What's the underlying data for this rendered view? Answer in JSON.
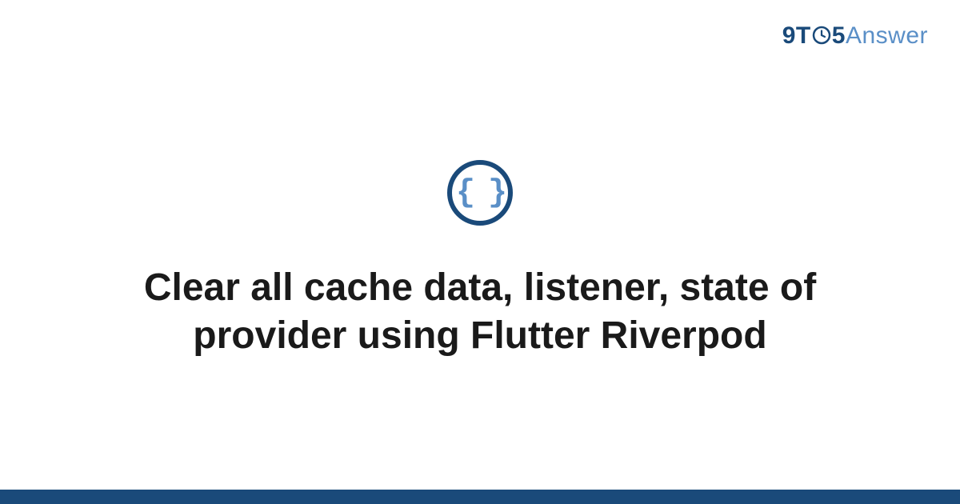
{
  "header": {
    "logo": {
      "prefix": "9T",
      "suffix": "5",
      "answer": "Answer"
    }
  },
  "main": {
    "icon_label": "{ }",
    "title": "Clear all cache data, listener, state of provider using Flutter Riverpod"
  },
  "colors": {
    "brand_dark": "#1a4a7a",
    "brand_light": "#5a8fc7"
  }
}
